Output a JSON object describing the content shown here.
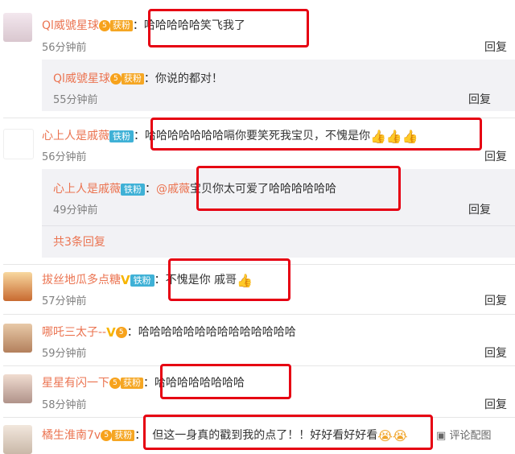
{
  "comments": [
    {
      "user": "Ql威號星球",
      "level": "5",
      "badge": "获粉",
      "text": "哈哈哈哈哈笑飞我了",
      "time": "56分钟前",
      "reply": "回复"
    },
    {
      "user": "Ql威號星球",
      "level": "5",
      "badge": "获粉",
      "text": "你说的都对！",
      "time": "55分钟前",
      "reply": "回复"
    },
    {
      "user": "心上人是戚薇",
      "badge": "铁粉",
      "text": "哈哈哈哈哈哈哈嗝你要笑死我宝贝，不愧是你",
      "emoji": "👍👍👍",
      "time": "56分钟前",
      "reply": "回复"
    },
    {
      "user": "心上人是戚薇",
      "badge": "铁粉",
      "mention": "@戚薇",
      "text": "宝贝你太可爱了哈哈哈哈哈哈",
      "time": "49分钟前",
      "reply": "回复"
    },
    {
      "user": "拔丝地瓜多点糖",
      "vip": "V",
      "badge": "铁粉",
      "text": "不愧是你 戚哥",
      "emoji": "👍",
      "time": "57分钟前",
      "reply": "回复"
    },
    {
      "user": "哪吒三太子--",
      "vip": "V",
      "level": "5",
      "text": "哈哈哈哈哈哈哈哈哈哈哈哈哈哈",
      "time": "59分钟前",
      "reply": "回复"
    },
    {
      "user": "星星有闪一下",
      "level": "5",
      "badge": "获粉",
      "text": "哈哈哈哈哈哈哈哈",
      "time": "58分钟前",
      "reply": "回复"
    },
    {
      "user": "橘生淮南7v",
      "level": "5",
      "badge": "获粉",
      "text": "但这一身真的戳到我的点了！！好好看好好看",
      "emoji": "😭😭",
      "action": "评论配图"
    }
  ],
  "more_replies": "共3条回复",
  "colon": "：",
  "colors": {
    "name": "#eb7350",
    "highlight": "#e60012",
    "subbg": "#f2f2f5"
  }
}
